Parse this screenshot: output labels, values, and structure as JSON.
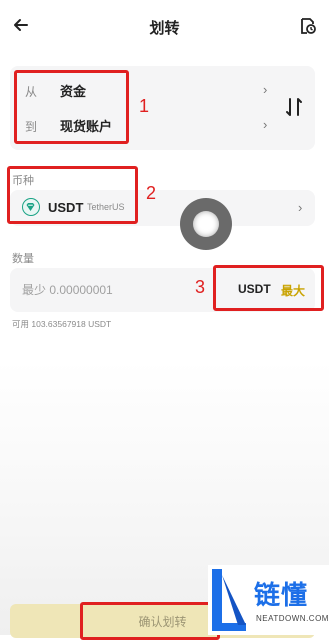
{
  "header": {
    "title": "划转",
    "back_icon": "back-arrow-icon",
    "history_icon": "history-icon"
  },
  "transfer": {
    "from_label": "从",
    "from_value": "资金",
    "to_label": "到",
    "to_value": "现货账户",
    "swap_icon": "swap-icon"
  },
  "coin": {
    "label": "币种",
    "symbol": "USDT",
    "name": "TetherUS",
    "icon": "tether-icon"
  },
  "amount": {
    "label": "数量",
    "placeholder": "最少 0.00000001",
    "unit": "USDT",
    "max_label": "最大",
    "available": "可用 103.63567918 USDT"
  },
  "confirm": {
    "label": "确认划转"
  },
  "annotations": {
    "n1": "1",
    "n2": "2",
    "n3": "3"
  },
  "watermark": {
    "brand": "链懂",
    "site": "NEATDOWN.COM"
  },
  "colors": {
    "accent": "#c9a300",
    "annotation": "#e02020",
    "tether": "#1aa385",
    "confirm_bg": "#efe6b7"
  }
}
